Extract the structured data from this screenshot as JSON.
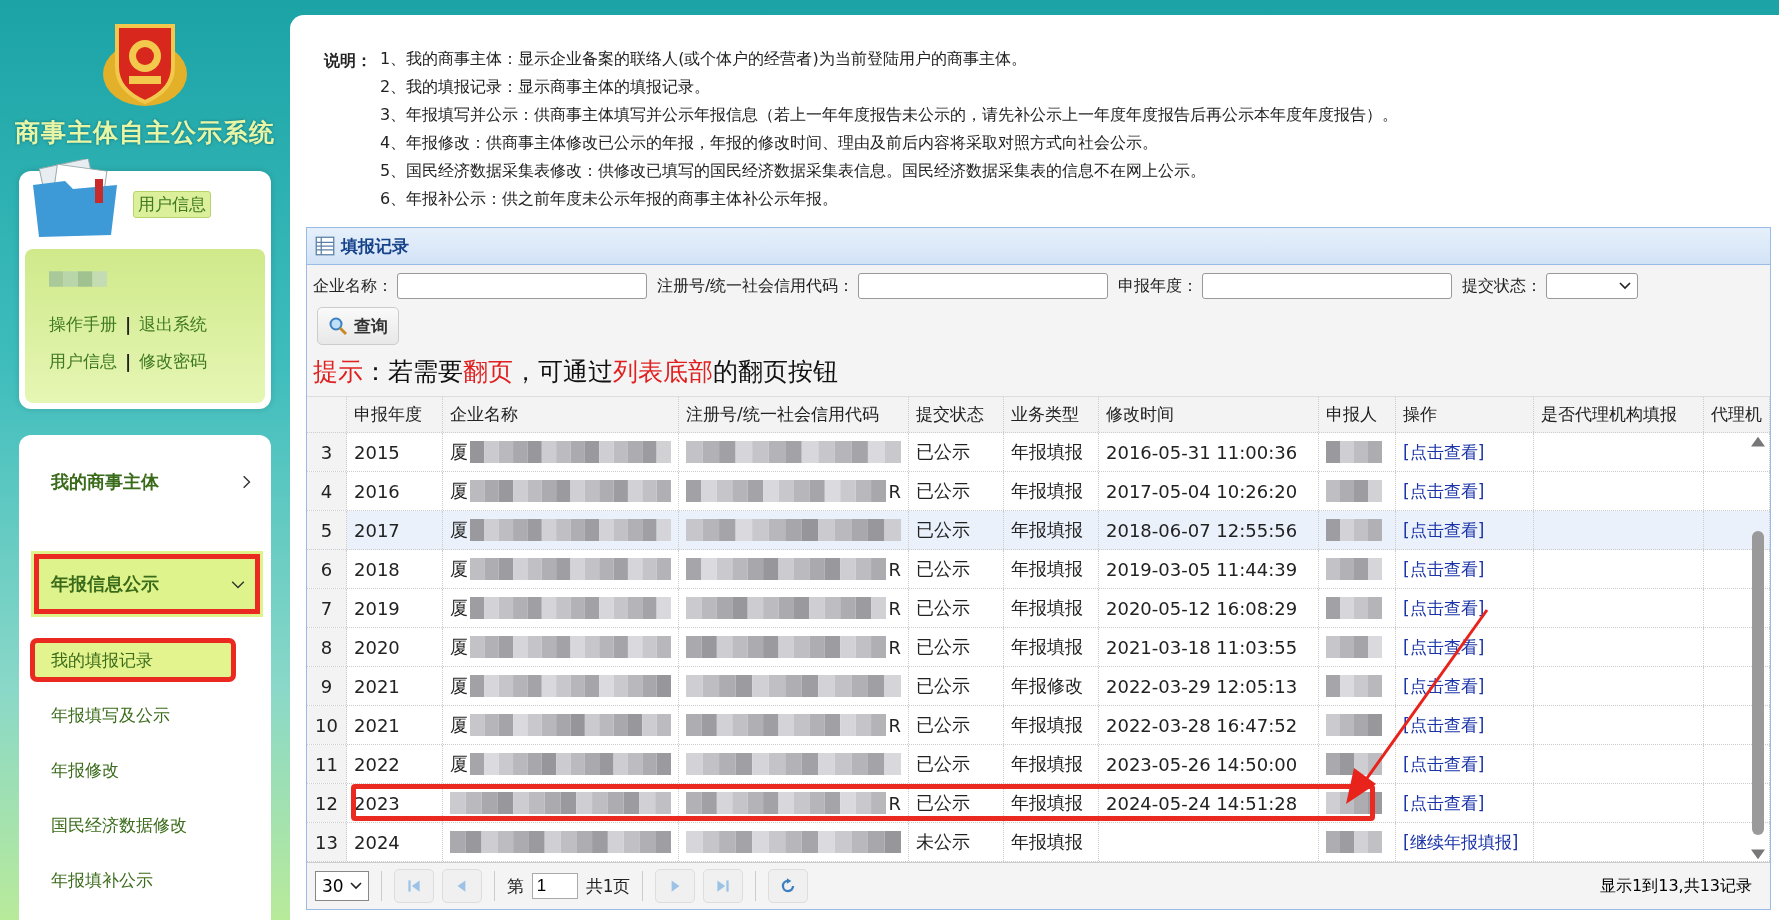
{
  "sidebar": {
    "system_title": "商事主体自主公示系统",
    "user_card": {
      "tag": "用户信息",
      "separator": "|",
      "links": [
        [
          "操作手册",
          "退出系统"
        ],
        [
          "用户信息",
          "修改密码"
        ]
      ]
    },
    "menu": [
      {
        "label": "我的商事主体",
        "expanded": false,
        "highlighted": false
      },
      {
        "label": "年报信息公示",
        "expanded": true,
        "highlighted": true,
        "children": [
          {
            "label": "我的填报记录",
            "selected": true,
            "highlighted": true
          },
          {
            "label": "年报填写及公示",
            "selected": false,
            "highlighted": false
          },
          {
            "label": "年报修改",
            "selected": false,
            "highlighted": false
          },
          {
            "label": "国民经济数据修改",
            "selected": false,
            "highlighted": false
          },
          {
            "label": "年报填补公示",
            "selected": false,
            "highlighted": false
          }
        ]
      }
    ]
  },
  "notes": {
    "label": "说明：",
    "items": [
      "1、我的商事主体：显示企业备案的联络人(或个体户的经营者)为当前登陆用户的商事主体。",
      "2、我的填报记录：显示商事主体的填报记录。",
      "3、年报填写并公示：供商事主体填写并公示年报信息（若上一年年度报告未公示的，请先补公示上一年度年度报告后再公示本年度年度报告）。",
      "4、年报修改：供商事主体修改已公示的年报，年报的修改时间、理由及前后内容将采取对照方式向社会公示。",
      "5、国民经济数据采集表修改：供修改已填写的国民经济数据采集表信息。国民经济数据采集表的信息不在网上公示。",
      "6、年报补公示：供之前年度未公示年报的商事主体补公示年报。"
    ]
  },
  "panel": {
    "title": "填报记录",
    "filters": [
      {
        "label": "企业名称：",
        "kind": "text"
      },
      {
        "label": "注册号/统一社会信用代码：",
        "kind": "text"
      },
      {
        "label": "申报年度：",
        "kind": "text"
      },
      {
        "label": "提交状态：",
        "kind": "select"
      }
    ],
    "query_button": "查询",
    "tip": [
      {
        "text": "提示",
        "red": true
      },
      {
        "text": "：若需要",
        "red": false
      },
      {
        "text": "翻页",
        "red": true
      },
      {
        "text": "，可通过",
        "red": false
      },
      {
        "text": "列表底部",
        "red": true
      },
      {
        "text": "的翻页按钮",
        "red": false
      }
    ],
    "columns": [
      "申报年度",
      "企业名称",
      "注册号/统一社会信用代码",
      "提交状态",
      "业务类型",
      "修改时间",
      "申报人",
      "操作",
      "是否代理机构填报",
      "代理机"
    ],
    "rows": [
      {
        "index": "3",
        "year": "2015",
        "company": "厦",
        "status": "已公示",
        "type": "年报填报",
        "time": "2016-05-31 11:00:36",
        "op": "[点击查看]",
        "selected": false,
        "highlighted": false
      },
      {
        "index": "4",
        "year": "2016",
        "company": "厦",
        "code": "R",
        "status": "已公示",
        "type": "年报填报",
        "time": "2017-05-04 10:26:20",
        "op": "[点击查看]",
        "selected": false,
        "highlighted": false
      },
      {
        "index": "5",
        "year": "2017",
        "company": "厦",
        "status": "已公示",
        "type": "年报填报",
        "time": "2018-06-07 12:55:56",
        "op": "[点击查看]",
        "selected": true,
        "highlighted": false
      },
      {
        "index": "6",
        "year": "2018",
        "company": "厦",
        "code": "R",
        "status": "已公示",
        "type": "年报填报",
        "time": "2019-03-05 11:44:39",
        "op": "[点击查看]",
        "selected": false,
        "highlighted": false
      },
      {
        "index": "7",
        "year": "2019",
        "company": "厦",
        "code": "R",
        "status": "已公示",
        "type": "年报填报",
        "time": "2020-05-12 16:08:29",
        "op": "[点击查看]",
        "selected": false,
        "highlighted": false
      },
      {
        "index": "8",
        "year": "2020",
        "company": "厦",
        "code": "R",
        "status": "已公示",
        "type": "年报填报",
        "time": "2021-03-18 11:03:55",
        "op": "[点击查看]",
        "selected": false,
        "highlighted": false
      },
      {
        "index": "9",
        "year": "2021",
        "company": "厦",
        "status": "已公示",
        "type": "年报修改",
        "time": "2022-03-29 12:05:13",
        "op": "[点击查看]",
        "selected": false,
        "highlighted": false
      },
      {
        "index": "10",
        "year": "2021",
        "company": "厦",
        "code": "R",
        "status": "已公示",
        "type": "年报填报",
        "time": "2022-03-28 16:47:52",
        "op": "[点击查看]",
        "selected": false,
        "highlighted": false
      },
      {
        "index": "11",
        "year": "2022",
        "company": "厦",
        "status": "已公示",
        "type": "年报填报",
        "time": "2023-05-26 14:50:00",
        "op": "[点击查看]",
        "selected": false,
        "highlighted": false
      },
      {
        "index": "12",
        "year": "2023",
        "code": "R",
        "status": "已公示",
        "type": "年报填报",
        "time": "2024-05-24 14:51:28",
        "op": "[点击查看]",
        "selected": false,
        "highlighted": true
      },
      {
        "index": "13",
        "year": "2024",
        "status": "未公示",
        "type": "年报填报",
        "op": "[继续年报填报]",
        "selected": false,
        "highlighted": false
      }
    ],
    "annotation_arrow": true,
    "pager": {
      "page_size": "30",
      "before": "第",
      "page": "1",
      "after": "共1页",
      "summary": "显示1到13,共13记录"
    }
  }
}
